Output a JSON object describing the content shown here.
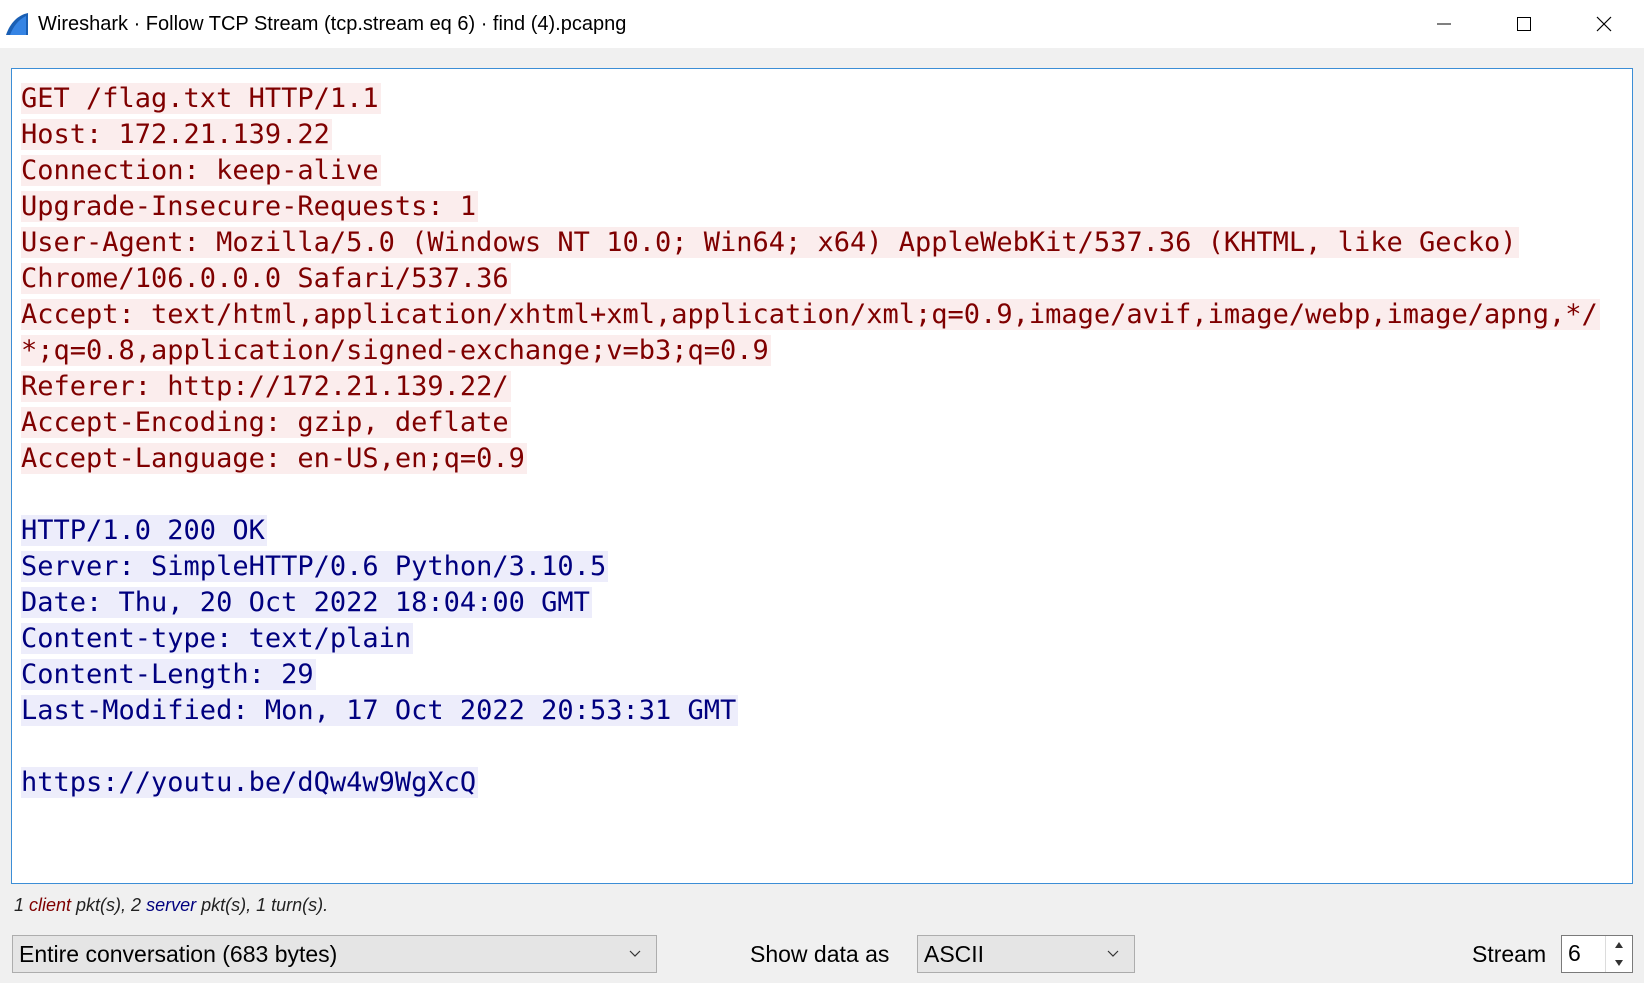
{
  "window": {
    "title": "Wireshark · Follow TCP Stream (tcp.stream eq 6) · find (4).pcapng",
    "icon": "wireshark-fin-icon",
    "controls": [
      "minimize-icon",
      "maximize-icon",
      "close-icon"
    ]
  },
  "stream": {
    "client_color": "#7f0000",
    "client_bg": "#fbeded",
    "server_color": "#00007f",
    "server_bg": "#ededfb",
    "client_lines": [
      "GET /flag.txt HTTP/1.1",
      "Host: 172.21.139.22",
      "Connection: keep-alive",
      "Upgrade-Insecure-Requests: 1",
      "User-Agent: Mozilla/5.0 (Windows NT 10.0; Win64; x64) AppleWebKit/537.36 (KHTML, like Gecko)",
      "Chrome/106.0.0.0 Safari/537.36",
      "Accept: text/html,application/xhtml+xml,application/xml;q=0.9,image/avif,image/webp,image/apng,*/",
      "*;q=0.8,application/signed-exchange;v=b3;q=0.9",
      "Referer: http://172.21.139.22/",
      "Accept-Encoding: gzip, deflate",
      "Accept-Language: en-US,en;q=0.9"
    ],
    "server_lines": [
      "HTTP/1.0 200 OK",
      "Server: SimpleHTTP/0.6 Python/3.10.5",
      "Date: Thu, 20 Oct 2022 18:04:00 GMT",
      "Content-type: text/plain",
      "Content-Length: 29",
      "Last-Modified: Mon, 17 Oct 2022 20:53:31 GMT"
    ],
    "body_lines": [
      "https://youtu.be/dQw4w9WgXcQ"
    ]
  },
  "status": {
    "prefix": "1 ",
    "client_word": "client",
    "middle": " pkt(s), 2 ",
    "server_word": "server",
    "suffix": " pkt(s), 1 turn(s)."
  },
  "controls": {
    "conversation_select": "Entire conversation (683 bytes)",
    "show_data_label": "Show data as",
    "show_data_select": "ASCII",
    "stream_label": "Stream",
    "stream_value": "6"
  }
}
